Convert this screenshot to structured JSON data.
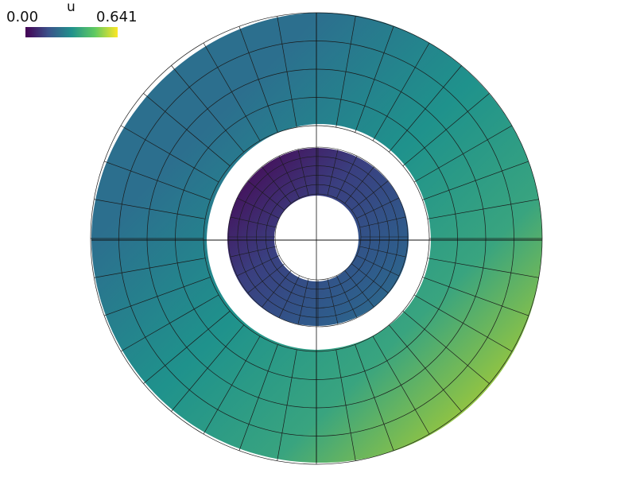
{
  "colorbar": {
    "title": "u",
    "min_label": "0.00",
    "max_label": "0.641",
    "colormap": "viridis"
  },
  "colors": {
    "background": "#ffffff",
    "mesh_lines": "#1a1a1a",
    "viridis_stops": [
      "#440154",
      "#3b528b",
      "#21918c",
      "#5ec962",
      "#fde725"
    ]
  },
  "field": {
    "min": 0.0,
    "max": 0.641
  }
}
